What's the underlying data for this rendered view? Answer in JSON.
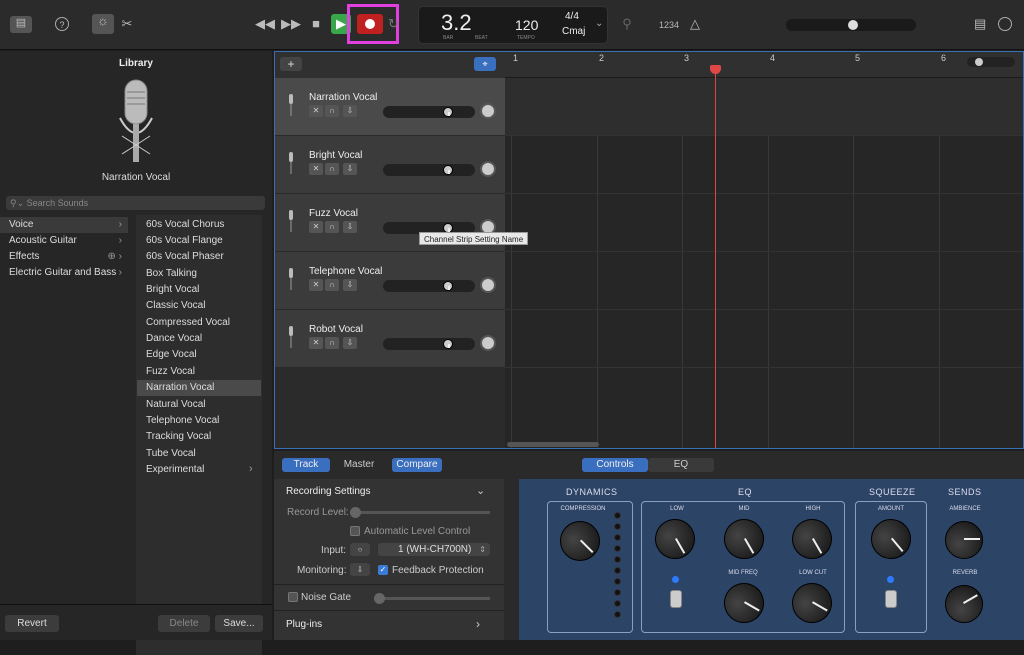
{
  "toolbar": {
    "lcd": {
      "bar_beat": "3.2",
      "bar_lbl": "BAR",
      "beat_lbl": "BEAT",
      "tempo": "120",
      "tempo_lbl": "TEMPO",
      "sig": "4/4",
      "key": "Cmaj"
    },
    "count_in": "1234"
  },
  "library": {
    "title": "Library",
    "instrument": "Narration Vocal",
    "search_placeholder": "Search Sounds",
    "categories": [
      "Voice",
      "Acoustic Guitar",
      "Effects",
      "Electric Guitar and Bass"
    ],
    "patches": [
      "60s Vocal Chorus",
      "60s Vocal Flange",
      "60s Vocal Phaser",
      "Box Talking",
      "Bright Vocal",
      "Classic Vocal",
      "Compressed Vocal",
      "Dance Vocal",
      "Edge Vocal",
      "Fuzz Vocal",
      "Narration Vocal",
      "Natural Vocal",
      "Telephone Vocal",
      "Tracking Vocal",
      "Tube Vocal",
      "Experimental"
    ],
    "revert": "Revert",
    "delete": "Delete",
    "save": "Save..."
  },
  "tracks": {
    "add": "+",
    "names": [
      "Narration Vocal",
      "Bright Vocal",
      "Fuzz Vocal",
      "Telephone Vocal",
      "Robot Vocal"
    ]
  },
  "ruler": [
    "1",
    "2",
    "3",
    "4",
    "5",
    "6"
  ],
  "tooltip": "Channel Strip Setting Name",
  "bottom": {
    "tabs": [
      "Track",
      "Master",
      "Compare"
    ],
    "view_tabs": [
      "Controls",
      "EQ"
    ],
    "recording_settings": "Recording Settings",
    "record_level": "Record Level:",
    "auto_level": "Automatic Level Control",
    "input": "Input:",
    "input_value": "1 (WH-CH700N)",
    "monitoring": "Monitoring:",
    "feedback": "Feedback Protection",
    "noise_gate": "Noise Gate",
    "plugins": "Plug-ins"
  },
  "plugin": {
    "dynamics": "DYNAMICS",
    "eq": "EQ",
    "squeeze": "SQUEEZE",
    "sends": "SENDS",
    "compression": "COMPRESSION",
    "low": "LOW",
    "mid": "MID",
    "high": "HIGH",
    "mid_freq": "MID FREQ",
    "low_cut": "LOW CUT",
    "amount": "AMOUNT",
    "ambience": "AMBIENCE",
    "reverb": "REVERB"
  }
}
